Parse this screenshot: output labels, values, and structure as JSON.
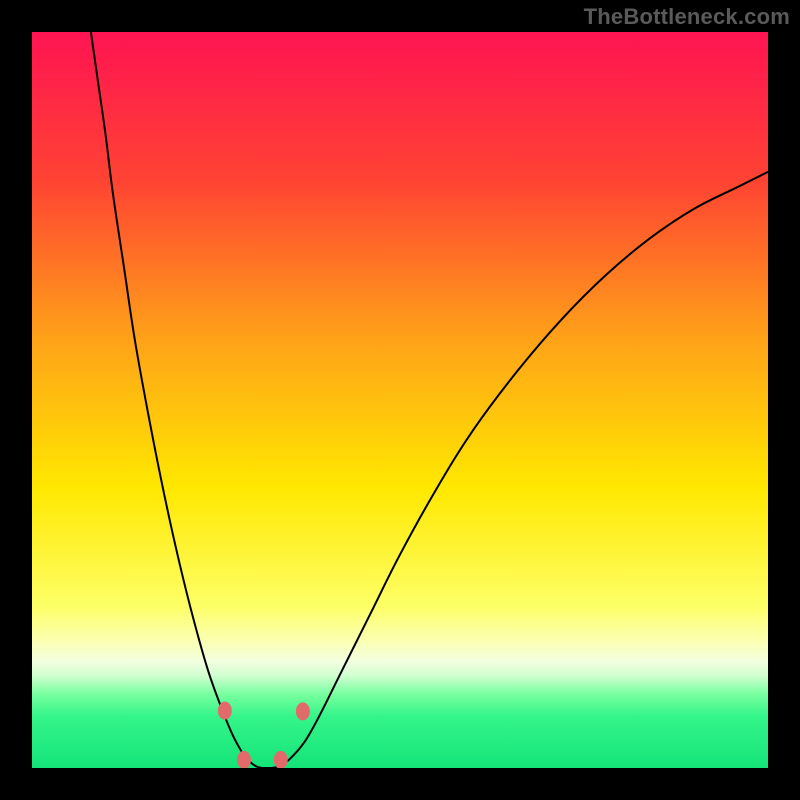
{
  "watermark": "TheBottleneck.com",
  "chart_data": {
    "type": "line",
    "title": "",
    "xlabel": "",
    "ylabel": "",
    "xlim": [
      0,
      100
    ],
    "ylim": [
      0,
      100
    ],
    "gradient_stops": [
      {
        "offset": 0.0,
        "color": "#ff1452"
      },
      {
        "offset": 0.2,
        "color": "#ff4233"
      },
      {
        "offset": 0.42,
        "color": "#ffa318"
      },
      {
        "offset": 0.62,
        "color": "#ffe800"
      },
      {
        "offset": 0.78,
        "color": "#fdff66"
      },
      {
        "offset": 0.83,
        "color": "#fbffb6"
      },
      {
        "offset": 0.855,
        "color": "#f3ffe0"
      },
      {
        "offset": 0.875,
        "color": "#cfffcf"
      },
      {
        "offset": 0.9,
        "color": "#77ff9f"
      },
      {
        "offset": 0.93,
        "color": "#34f58a"
      },
      {
        "offset": 1.0,
        "color": "#14e478"
      }
    ],
    "series": [
      {
        "name": "bottleneck-curve",
        "stroke": "#000000",
        "stroke_width": 2,
        "points": [
          {
            "x": 8.0,
            "y": 100.0
          },
          {
            "x": 9.0,
            "y": 93.0
          },
          {
            "x": 10.0,
            "y": 86.0
          },
          {
            "x": 11.0,
            "y": 78.0
          },
          {
            "x": 12.5,
            "y": 68.0
          },
          {
            "x": 14.0,
            "y": 58.0
          },
          {
            "x": 16.0,
            "y": 47.0
          },
          {
            "x": 18.0,
            "y": 37.0
          },
          {
            "x": 20.0,
            "y": 28.0
          },
          {
            "x": 22.0,
            "y": 20.0
          },
          {
            "x": 24.0,
            "y": 13.0
          },
          {
            "x": 26.0,
            "y": 7.5
          },
          {
            "x": 27.5,
            "y": 4.0
          },
          {
            "x": 29.0,
            "y": 1.5
          },
          {
            "x": 30.5,
            "y": 0.2
          },
          {
            "x": 32.0,
            "y": 0.0
          },
          {
            "x": 33.5,
            "y": 0.2
          },
          {
            "x": 35.0,
            "y": 1.2
          },
          {
            "x": 37.0,
            "y": 3.5
          },
          {
            "x": 39.0,
            "y": 7.0
          },
          {
            "x": 42.0,
            "y": 13.0
          },
          {
            "x": 46.0,
            "y": 21.0
          },
          {
            "x": 50.0,
            "y": 29.0
          },
          {
            "x": 55.0,
            "y": 38.0
          },
          {
            "x": 60.0,
            "y": 46.0
          },
          {
            "x": 66.0,
            "y": 54.0
          },
          {
            "x": 72.0,
            "y": 61.0
          },
          {
            "x": 78.0,
            "y": 67.0
          },
          {
            "x": 84.0,
            "y": 72.0
          },
          {
            "x": 90.0,
            "y": 76.0
          },
          {
            "x": 96.0,
            "y": 79.0
          },
          {
            "x": 100.0,
            "y": 81.0
          }
        ]
      }
    ],
    "markers": {
      "fill": "#e26a6a",
      "rx": 7,
      "ry": 9,
      "points": [
        {
          "x": 26.2,
          "y": 7.8
        },
        {
          "x": 28.8,
          "y": 1.1
        },
        {
          "x": 33.8,
          "y": 1.1
        },
        {
          "x": 36.8,
          "y": 7.7
        }
      ]
    }
  }
}
